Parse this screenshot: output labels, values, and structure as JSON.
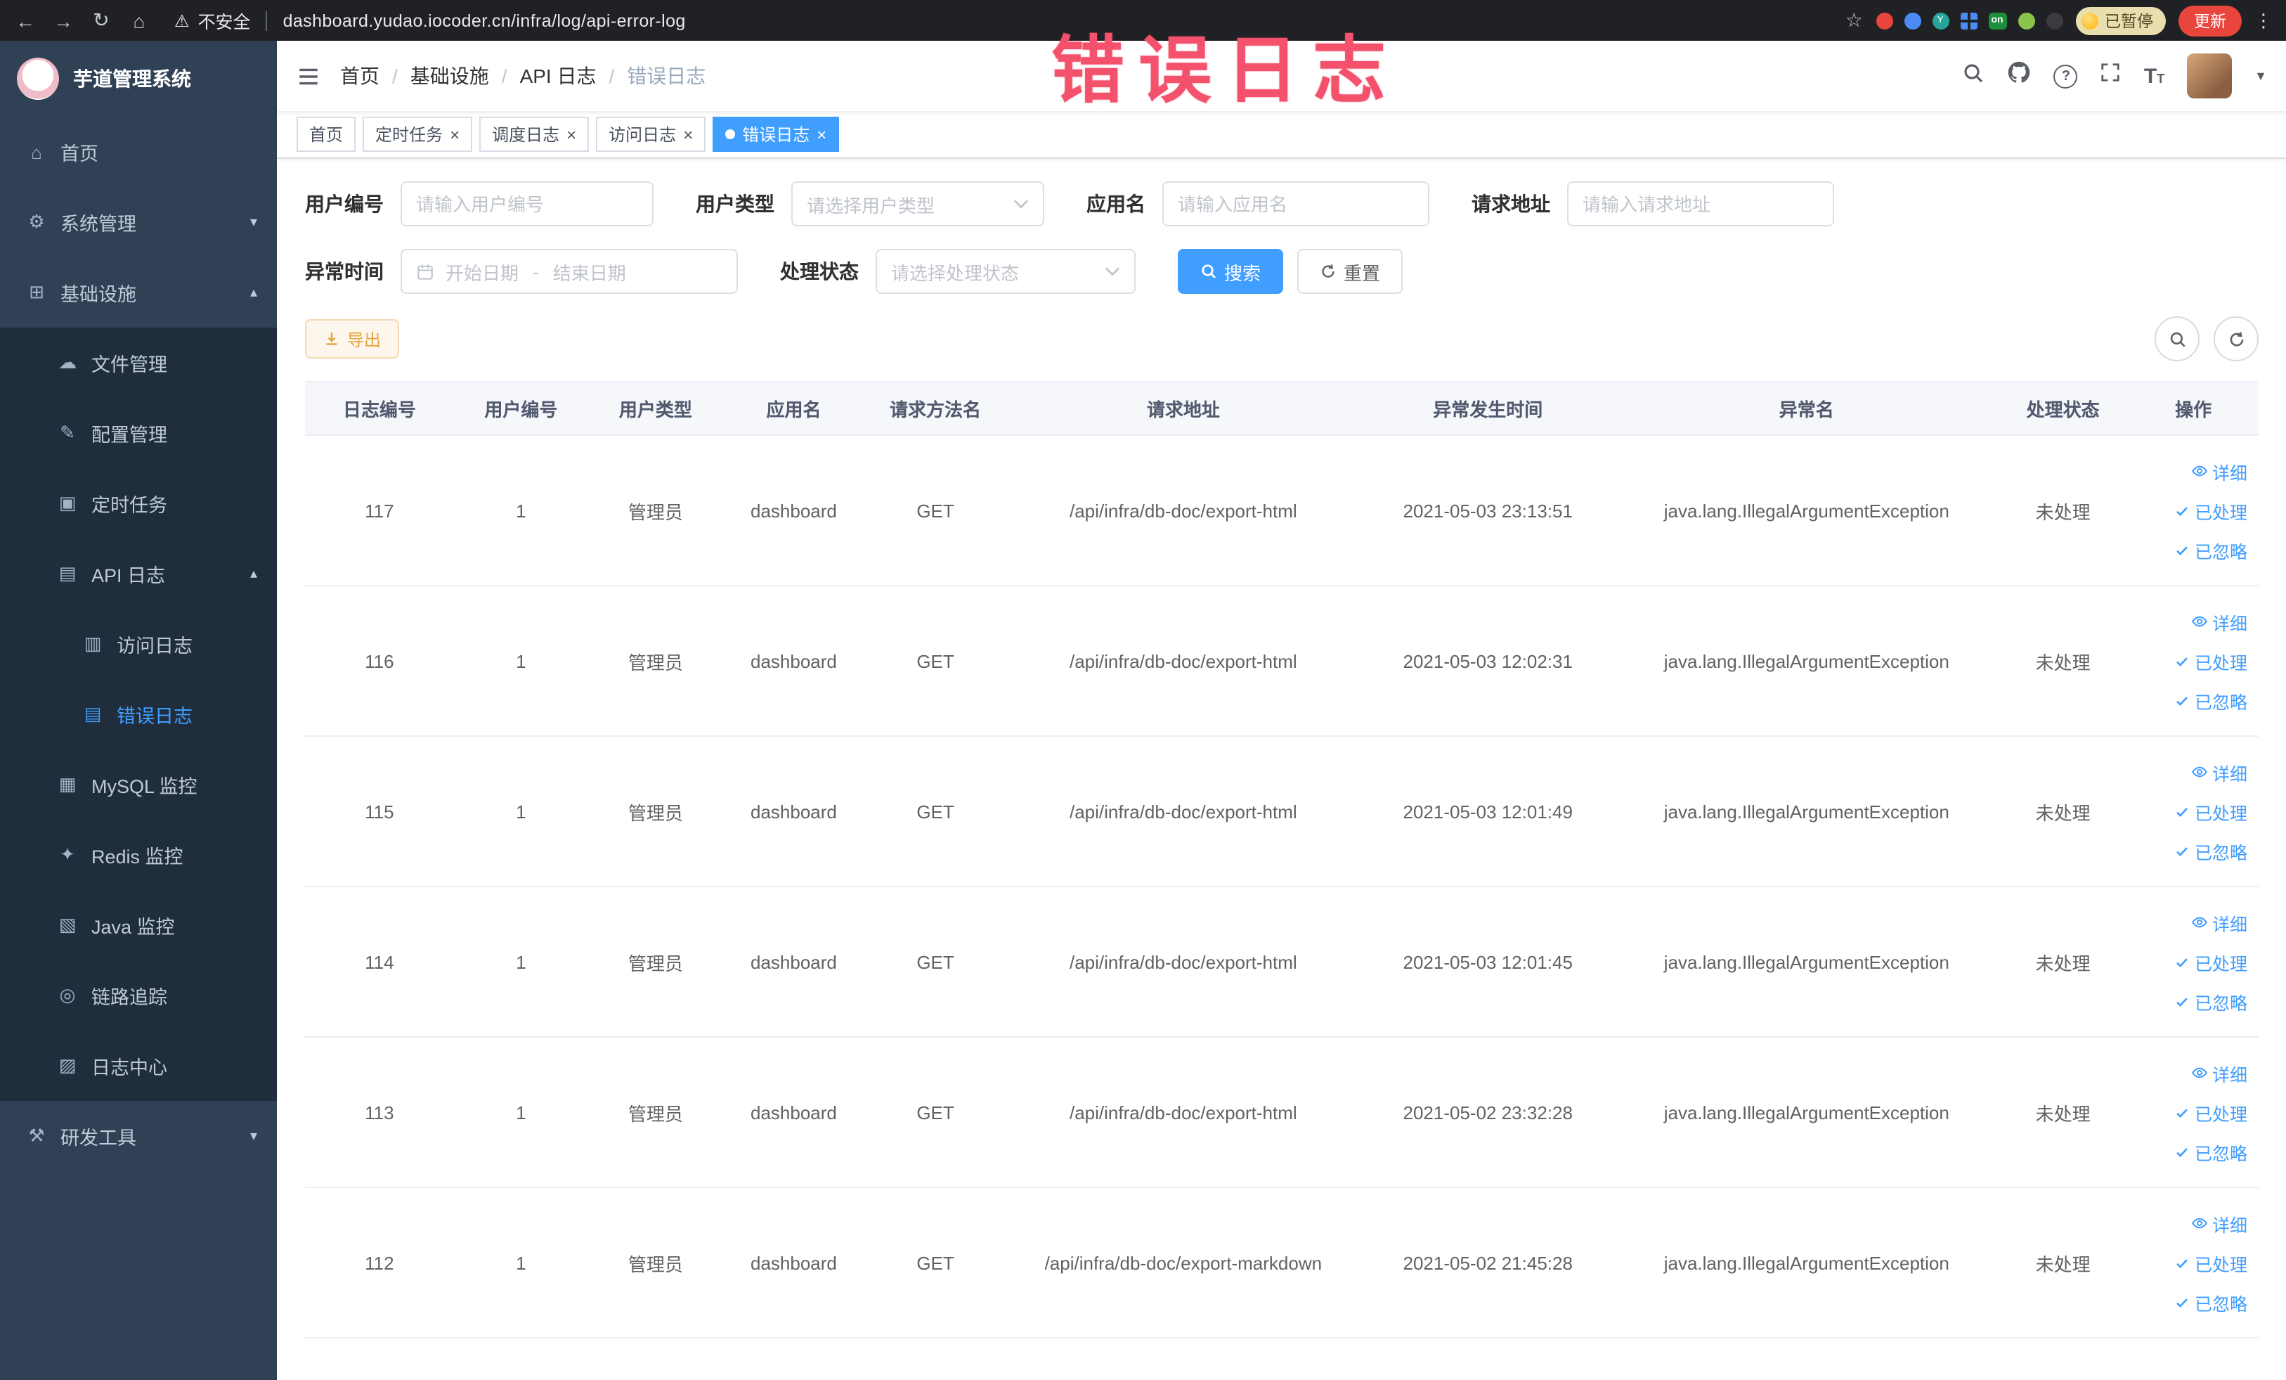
{
  "annotation": {
    "text": "错误日志"
  },
  "browser": {
    "security_label": "不安全",
    "url": "dashboard.yudao.iocoder.cn/infra/log/api-error-log",
    "paused_badge": "已暂停",
    "update_label": "更新",
    "extensions": [
      {
        "name": "extension-red",
        "shape": "circle",
        "color": "#e8453c",
        "text": ""
      },
      {
        "name": "extension-blue",
        "shape": "circle",
        "color": "#4c8bf5",
        "text": ""
      },
      {
        "name": "extension-teal",
        "shape": "circle",
        "color": "#26a69a",
        "text": "Y"
      },
      {
        "name": "extension-grid",
        "shape": "grid",
        "color": "#4c8bf5",
        "text": ""
      },
      {
        "name": "extension-on-badge",
        "shape": "square",
        "color": "#1e8e3e",
        "text": "on"
      },
      {
        "name": "extension-leaf",
        "shape": "circle",
        "color": "#8bc34a",
        "text": ""
      },
      {
        "name": "extension-paw",
        "shape": "circle",
        "color": "#3a3b3e",
        "text": ""
      }
    ]
  },
  "sidebar": {
    "app_title": "芋道管理系统",
    "menu": [
      {
        "name": "home",
        "label": "首页",
        "icon": "⌂",
        "level": 0,
        "arrow": "",
        "active": false
      },
      {
        "name": "system",
        "label": "系统管理",
        "icon": "⚙",
        "level": 0,
        "arrow": "down",
        "active": false
      },
      {
        "name": "infra",
        "label": "基础设施",
        "icon": "⊞",
        "level": 0,
        "arrow": "up",
        "active": false
      },
      {
        "name": "file-manage",
        "label": "文件管理",
        "icon": "☁",
        "level": 1,
        "arrow": "",
        "active": false
      },
      {
        "name": "config-manage",
        "label": "配置管理",
        "icon": "✎",
        "level": 1,
        "arrow": "",
        "active": false
      },
      {
        "name": "scheduled-job",
        "label": "定时任务",
        "icon": "▣",
        "level": 1,
        "arrow": "",
        "active": false
      },
      {
        "name": "api-log",
        "label": "API 日志",
        "icon": "▤",
        "level": 1,
        "arrow": "up",
        "active": false
      },
      {
        "name": "access-log",
        "label": "访问日志",
        "icon": "▥",
        "level": 2,
        "arrow": "",
        "active": false
      },
      {
        "name": "error-log",
        "label": "错误日志",
        "icon": "▤",
        "level": 2,
        "arrow": "",
        "active": true
      },
      {
        "name": "mysql-monitor",
        "label": "MySQL 监控",
        "icon": "▦",
        "level": 1,
        "arrow": "",
        "active": false
      },
      {
        "name": "redis-monitor",
        "label": "Redis 监控",
        "icon": "✦",
        "level": 1,
        "arrow": "",
        "active": false
      },
      {
        "name": "java-monitor",
        "label": "Java 监控",
        "icon": "▧",
        "level": 1,
        "arrow": "",
        "active": false
      },
      {
        "name": "trace",
        "label": "链路追踪",
        "icon": "◎",
        "level": 1,
        "arrow": "",
        "active": false
      },
      {
        "name": "log-center",
        "label": "日志中心",
        "icon": "▨",
        "level": 1,
        "arrow": "",
        "active": false
      },
      {
        "name": "dev-tools",
        "label": "研发工具",
        "icon": "⚒",
        "level": 0,
        "arrow": "down",
        "active": false
      }
    ]
  },
  "header": {
    "breadcrumb": [
      {
        "label": "首页",
        "current": false
      },
      {
        "label": "基础设施",
        "current": false
      },
      {
        "label": "API 日志",
        "current": false
      },
      {
        "label": "错误日志",
        "current": true
      }
    ]
  },
  "tabs": [
    {
      "label": "首页",
      "closable": false,
      "active": false
    },
    {
      "label": "定时任务",
      "closable": true,
      "active": false
    },
    {
      "label": "调度日志",
      "closable": true,
      "active": false
    },
    {
      "label": "访问日志",
      "closable": true,
      "active": false
    },
    {
      "label": "错误日志",
      "closable": true,
      "active": true
    }
  ],
  "filters": {
    "user_id": {
      "label": "用户编号",
      "placeholder": "请输入用户编号",
      "value": ""
    },
    "user_type": {
      "label": "用户类型",
      "placeholder": "请选择用户类型",
      "value": ""
    },
    "app_name": {
      "label": "应用名",
      "placeholder": "请输入应用名",
      "value": ""
    },
    "request_url": {
      "label": "请求地址",
      "placeholder": "请输入请求地址",
      "value": ""
    },
    "exception_time": {
      "label": "异常时间",
      "start_placeholder": "开始日期",
      "separator": "-",
      "end_placeholder": "结束日期"
    },
    "process_status": {
      "label": "处理状态",
      "placeholder": "请选择处理状态",
      "value": ""
    },
    "search_label": "搜索",
    "reset_label": "重置"
  },
  "toolbar": {
    "export_label": "导出"
  },
  "table": {
    "columns": [
      "日志编号",
      "用户编号",
      "用户类型",
      "应用名",
      "请求方法名",
      "请求地址",
      "异常发生时间",
      "异常名",
      "处理状态",
      "操作"
    ],
    "actions": [
      {
        "name": "detail",
        "label": "详细",
        "icon": "eye"
      },
      {
        "name": "processed",
        "label": "已处理",
        "icon": "check"
      },
      {
        "name": "ignored",
        "label": "已忽略",
        "icon": "check"
      }
    ],
    "rows": [
      {
        "log_id": "117",
        "user_id": "1",
        "user_type": "管理员",
        "app_name": "dashboard",
        "method": "GET",
        "url": "/api/infra/db-doc/export-html",
        "time": "2021-05-03 23:13:51",
        "exception": "java.lang.IllegalArgumentException",
        "status": "未处理"
      },
      {
        "log_id": "116",
        "user_id": "1",
        "user_type": "管理员",
        "app_name": "dashboard",
        "method": "GET",
        "url": "/api/infra/db-doc/export-html",
        "time": "2021-05-03 12:02:31",
        "exception": "java.lang.IllegalArgumentException",
        "status": "未处理"
      },
      {
        "log_id": "115",
        "user_id": "1",
        "user_type": "管理员",
        "app_name": "dashboard",
        "method": "GET",
        "url": "/api/infra/db-doc/export-html",
        "time": "2021-05-03 12:01:49",
        "exception": "java.lang.IllegalArgumentException",
        "status": "未处理"
      },
      {
        "log_id": "114",
        "user_id": "1",
        "user_type": "管理员",
        "app_name": "dashboard",
        "method": "GET",
        "url": "/api/infra/db-doc/export-html",
        "time": "2021-05-03 12:01:45",
        "exception": "java.lang.IllegalArgumentException",
        "status": "未处理"
      },
      {
        "log_id": "113",
        "user_id": "1",
        "user_type": "管理员",
        "app_name": "dashboard",
        "method": "GET",
        "url": "/api/infra/db-doc/export-html",
        "time": "2021-05-02 23:32:28",
        "exception": "java.lang.IllegalArgumentException",
        "status": "未处理"
      },
      {
        "log_id": "112",
        "user_id": "1",
        "user_type": "管理员",
        "app_name": "dashboard",
        "method": "GET",
        "url": "/api/infra/db-doc/export-markdown",
        "time": "2021-05-02 21:45:28",
        "exception": "java.lang.IllegalArgumentException",
        "status": "未处理"
      }
    ]
  },
  "colors": {
    "accent": "#409EFF",
    "warning": "#E6A23C",
    "annotation": "#F4516C",
    "sidebar_bg": "#304156",
    "sidebar_sub_bg": "#1F2D3D",
    "active_tab_bg": "#409EFF",
    "update_button_bg": "#E8453C"
  }
}
